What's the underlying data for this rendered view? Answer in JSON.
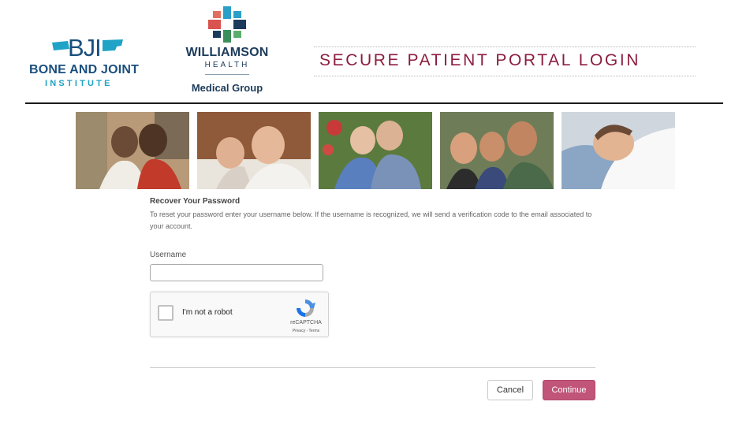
{
  "header": {
    "bji_logo": {
      "mark_text": "BJI",
      "line1": "BONE AND JOINT",
      "line2": "INSTITUTE"
    },
    "wh_logo": {
      "name": "WILLIAMSON",
      "sub": "HEALTH",
      "group": "Medical Group"
    },
    "portal_title": "SECURE PATIENT PORTAL LOGIN"
  },
  "photos": [
    {
      "name": "photo-couple-smiling"
    },
    {
      "name": "photo-couple-relaxing"
    },
    {
      "name": "photo-elderly-couple"
    },
    {
      "name": "photo-family"
    },
    {
      "name": "photo-man-sleeping"
    }
  ],
  "form": {
    "title": "Recover Your Password",
    "description": "To reset your password enter your username below. If the username is recognized, we will send a verification code to the email associated to your account.",
    "username_label": "Username",
    "username_value": "",
    "captcha": {
      "label": "I'm not a robot",
      "brand": "reCAPTCHA",
      "links": "Privacy - Terms"
    },
    "cancel_label": "Cancel",
    "continue_label": "Continue"
  },
  "colors": {
    "title_maroon": "#8c1d40",
    "button_pink": "#c05579",
    "bji_navy": "#1a4f7d",
    "bji_teal": "#1fa3c6"
  }
}
